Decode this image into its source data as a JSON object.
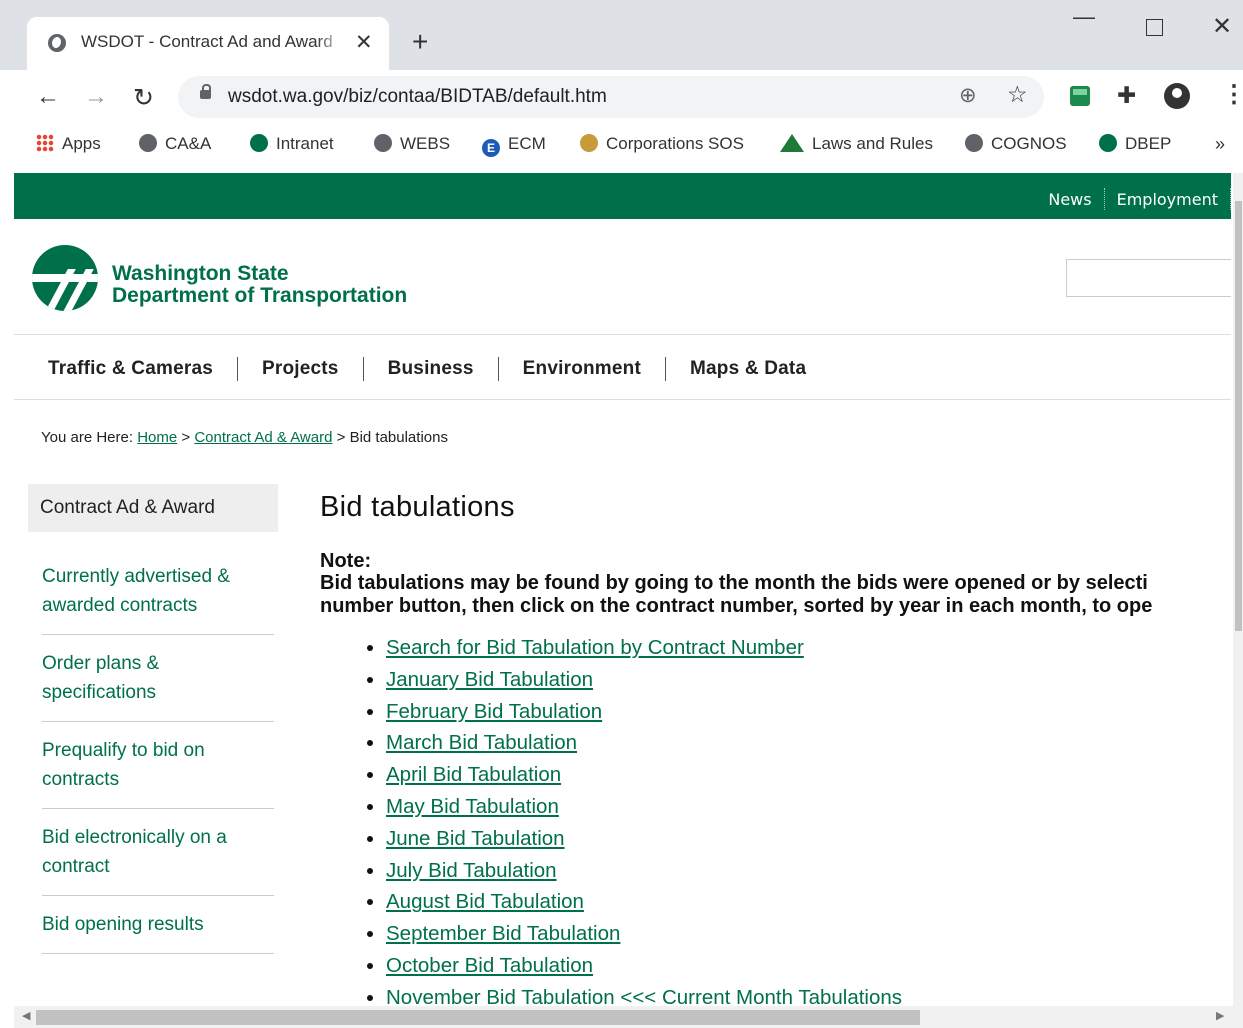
{
  "browser": {
    "tab_title": "WSDOT - Contract Ad and Award",
    "tab_close": "✕",
    "new_tab": "+",
    "url": "wsdot.wa.gov/biz/contaa/BIDTAB/default.htm",
    "window_controls": {
      "minimize": "—",
      "close": "✕"
    },
    "nav": {
      "back": "←",
      "forward": "→",
      "reload": "↻"
    },
    "icons": {
      "zoom": "⊕",
      "star": "☆",
      "puzzle": "✚",
      "menu": "⋮"
    },
    "bookmarks": [
      {
        "label": "Apps",
        "icon": "apps-grid-icon"
      },
      {
        "label": "CA&A",
        "icon": "globe-icon"
      },
      {
        "label": "Intranet",
        "icon": "wsdot-logo-icon"
      },
      {
        "label": "WEBS",
        "icon": "globe-icon"
      },
      {
        "label": "ECM",
        "icon": "e-letter-icon"
      },
      {
        "label": "Corporations SOS",
        "icon": "seal-icon"
      },
      {
        "label": "Laws and Rules",
        "icon": "mountain-icon"
      },
      {
        "label": "COGNOS",
        "icon": "globe-icon"
      },
      {
        "label": "DBEP",
        "icon": "wsdot-logo-icon"
      }
    ],
    "bookmarks_more": "»"
  },
  "site": {
    "top_links": [
      "News",
      "Employment"
    ],
    "logo_line1": "Washington State",
    "logo_line2": "Department of Transportation",
    "main_nav": [
      "Traffic & Cameras",
      "Projects",
      "Business",
      "Environment",
      "Maps & Data"
    ],
    "breadcrumb": {
      "prefix": "You are Here:",
      "home": "Home",
      "sep1": ">",
      "section": "Contract Ad & Award",
      "sep2": ">",
      "current": "Bid tabulations"
    },
    "sidebar": {
      "heading": "Contract Ad & Award",
      "items": [
        "Currently advertised & awarded contracts",
        "Order plans & specifications",
        "Prequalify to bid on contracts",
        "Bid electronically on a contract",
        "Bid opening results"
      ]
    },
    "content": {
      "title": "Bid tabulations",
      "note_label": "Note:",
      "note_line1": "Bid tabulations may be found by going to the month the bids were opened or by selecti",
      "note_line2": "number button, then click on the contract number, sorted by year in each month, to ope",
      "links": [
        "Search for Bid Tabulation by Contract Number",
        "January Bid Tabulation",
        "February Bid Tabulation",
        "March Bid Tabulation",
        "April Bid Tabulation",
        "May Bid Tabulation",
        "June Bid Tabulation",
        "July Bid Tabulation",
        "August Bid Tabulation",
        "September Bid Tabulation",
        "October Bid Tabulation",
        "November Bid Tabulation <<< Current Month Tabulations"
      ]
    }
  }
}
